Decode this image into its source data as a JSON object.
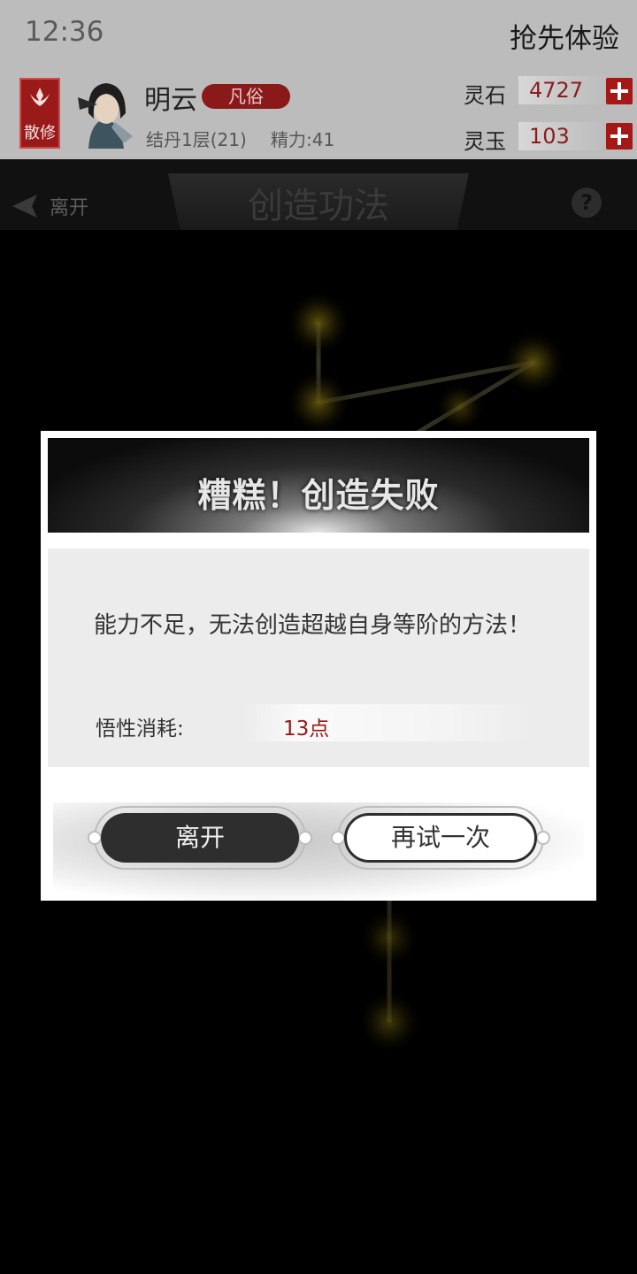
{
  "status": {
    "time": "12:36",
    "early_access": "抢先体验"
  },
  "player": {
    "sect": "散修",
    "name": "明云",
    "rank": "凡俗",
    "realm": "结丹1层(21)",
    "stamina": "精力:41"
  },
  "currency": {
    "spirit_stone_label": "灵石",
    "spirit_stone_value": "4727",
    "spirit_jade_label": "灵玉",
    "spirit_jade_value": "103"
  },
  "nav": {
    "back_label": "离开",
    "title": "创造功法"
  },
  "modal": {
    "title": "糟糕！创造失败",
    "message": "能力不足，无法创造超越自身等阶的方法！",
    "cost_label": "悟性消耗:",
    "cost_value": "13点",
    "leave_button": "离开",
    "retry_button": "再试一次"
  },
  "colors": {
    "accent_red": "#a51818",
    "cost_red": "#9a1616",
    "dark_button": "#2e2e2e"
  }
}
